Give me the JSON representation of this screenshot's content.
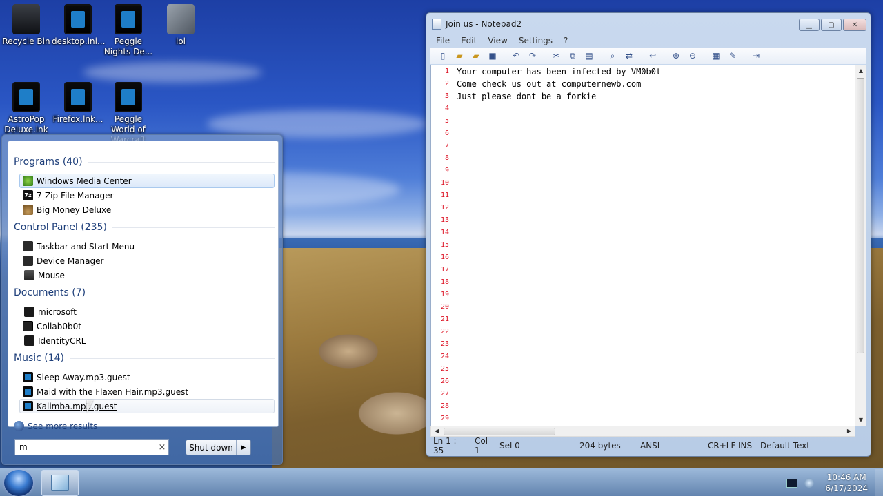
{
  "desktop": {
    "icons": [
      {
        "label": "Recycle Bin",
        "icon": "recycle-bin-icon"
      },
      {
        "label": "desktop.ini...",
        "icon": "file-icon"
      },
      {
        "label": "Peggle Nights De...",
        "icon": "app-shortcut-icon"
      },
      {
        "label": "lol",
        "icon": "folder-icon"
      },
      {
        "label": "AstroPop Deluxe.lnk",
        "icon": "app-shortcut-icon"
      },
      {
        "label": "Firefox.lnk...",
        "icon": "app-shortcut-icon"
      },
      {
        "label": "Peggle World of Warcraft",
        "icon": "app-shortcut-icon"
      }
    ]
  },
  "start_menu": {
    "categories": [
      {
        "label": "Programs (40)",
        "items": [
          "Windows Media Center",
          "7-Zip File Manager",
          "Big Money Deluxe"
        ]
      },
      {
        "label": "Control Panel (235)",
        "items": [
          "Taskbar and Start Menu",
          "Device Manager",
          "Mouse"
        ]
      },
      {
        "label": "Documents (7)",
        "items": [
          "microsoft",
          "Collab0b0t",
          "IdentityCRL"
        ]
      },
      {
        "label": "Music (14)",
        "items": [
          "Sleep Away.mp3.guest",
          "Maid with the Flaxen Hair.mp3.guest",
          "Kalimba.mp3.guest"
        ]
      }
    ],
    "see_more": "See more results",
    "search_value": "m",
    "clear_glyph": "×",
    "shutdown_label": "Shut down",
    "shutdown_arrow": "▶"
  },
  "notepad": {
    "title": "Join us - Notepad2",
    "menu": [
      "File",
      "Edit",
      "View",
      "Settings",
      "?"
    ],
    "lines": [
      "Your computer has been infected by VM0b0t",
      "Come check us out at computernewb.com",
      "Just please dont be a forkie"
    ],
    "line_numbers": [
      "1",
      "2",
      "3",
      "4",
      "5",
      "6",
      "7",
      "8",
      "9",
      "10",
      "11",
      "12",
      "13",
      "14",
      "15",
      "16",
      "17",
      "18",
      "19",
      "20",
      "21",
      "22",
      "23",
      "24",
      "25",
      "26",
      "27",
      "28",
      "29"
    ],
    "status": {
      "position": "Ln 1 : 35",
      "col": "Col 1",
      "sel": "Sel 0",
      "size": "204 bytes",
      "encoding": "ANSI",
      "line_endings": "CR+LF",
      "mode": "INS",
      "scheme": "Default Text"
    }
  },
  "taskbar": {
    "time": "10:46 AM",
    "date": "6/17/2024"
  }
}
